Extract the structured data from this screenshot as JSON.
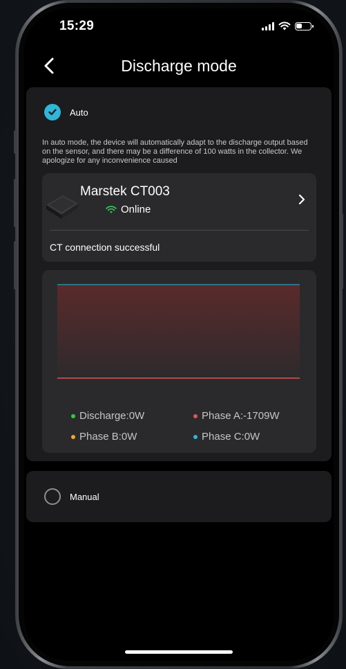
{
  "status_bar": {
    "time": "15:29"
  },
  "header": {
    "title": "Discharge mode"
  },
  "auto_option": {
    "label": "Auto",
    "selected": true,
    "description": "In auto mode, the device will automatically adapt to the discharge output based on the sensor, and there may be a difference of 100 watts in the collector. We apologize for any inconvenience caused"
  },
  "device": {
    "name": "Marstek CT003",
    "status": "Online",
    "connection_message": "CT connection successful"
  },
  "legend": [
    {
      "label": "Discharge:0W",
      "color": "#2ecc40"
    },
    {
      "label": "Phase A:-1709W",
      "color": "#e05555"
    },
    {
      "label": "Phase B:0W",
      "color": "#f5a623"
    },
    {
      "label": "Phase C:0W",
      "color": "#2fb6d8"
    }
  ],
  "manual_option": {
    "label": "Manual",
    "selected": false
  },
  "colors": {
    "accent": "#2fb6d8",
    "online": "#34c759"
  }
}
